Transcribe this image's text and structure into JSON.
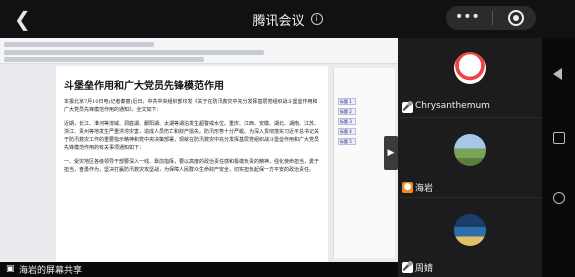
{
  "header": {
    "title": "腾讯会议",
    "back_icon": "back-icon",
    "info_icon": "info-icon",
    "more_icon": "more-icon",
    "record_icon": "record-icon"
  },
  "shared_screen": {
    "document_heading": "斗堡垒作用和广大党员先锋模范作用",
    "paragraphs": [
      "本报北京7月10日电(记者秦丽)近日，中共中央组织部印发《关于在防汛救灾中充分发挥基层党组织战斗堡垒作用和广大党员先锋模范作用的通知》。全文如下：",
      "近期，长江、淮河等流域、洞庭湖、鄱阳湖、太湖等湖泊发生超警戒水位。重庆、江西、安徽、湖北、湖南、江苏、浙江、贵州等地发生严重洪涝灾害，造成人员伤亡和财产损失。防汛形势十分严峻。为深入贯彻落实习近平总书记关于防汛救灾工作的重要指示精神和党中央决策部署，现就在防汛救灾中充分发挥基层党组织战斗堡垒作用和广大党员先锋模范作用的有关事项通知如下：",
      "一、受灾地区各级领导干部要深入一线、靠前指挥，要以高度的政治责任感和极端负责的精神，强化使命担当，勇于担当，奋勇作为，坚决打赢防汛救灾攻坚战，为保障人民群众生命财产安全，切实担负起保一方平安的政治责任。"
    ],
    "side_panel": {
      "tags": [
        "标题 1",
        "标题 2",
        "标题 3",
        "标题 4",
        "标题 5"
      ]
    },
    "expand_icon": "chevron-right-icon",
    "sharer_label": "海岩的屏幕共享",
    "sharer_icon": "screen-share-icon",
    "progress": 0.06
  },
  "participants": [
    {
      "name": "Chrysanthemum",
      "avatar": "snowman-avatar",
      "mic_icon": "mic-on-icon"
    },
    {
      "name": "海岩",
      "avatar": "landscape-avatar",
      "mic_icon": "user-icon"
    },
    {
      "name": "周婧",
      "avatar": "lake-avatar",
      "mic_icon": "mic-on-icon"
    }
  ],
  "colors": {
    "background": "#0a0a0a",
    "panel": "#1c1c1e",
    "accent_orange": "#f08a24"
  }
}
